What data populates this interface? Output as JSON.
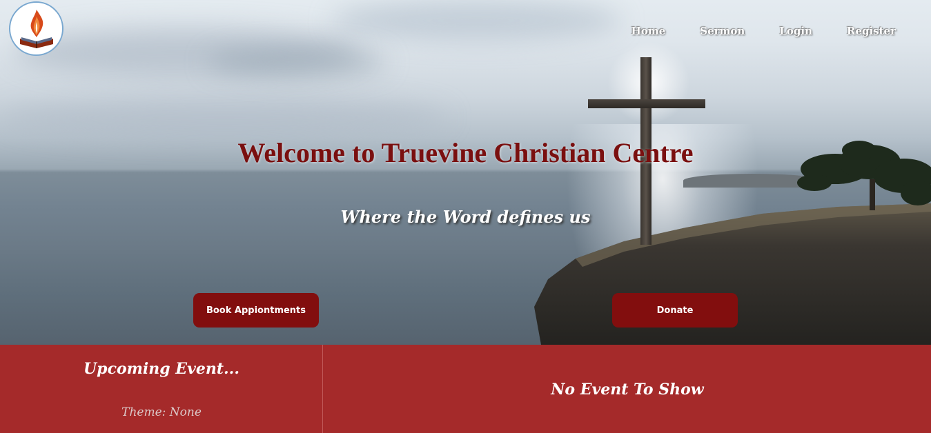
{
  "header": {
    "logo_icon": "flame-bible-logo-icon",
    "nav": [
      {
        "label": "Home"
      },
      {
        "label": "Sermon"
      },
      {
        "label": "Login"
      },
      {
        "label": "Register"
      }
    ]
  },
  "hero": {
    "title": "Welcome to Truevine Christian Centre",
    "subtitle": "Where the Word defines us",
    "book_button": "Book Appiontments",
    "donate_button": "Donate"
  },
  "events": {
    "heading": "Upcoming Event...",
    "theme": "Theme: None",
    "empty_message": "No Event To Show"
  },
  "colors": {
    "brand_red": "#820e0e",
    "section_red": "#a52a2a",
    "title_red": "#7a0f0f"
  }
}
